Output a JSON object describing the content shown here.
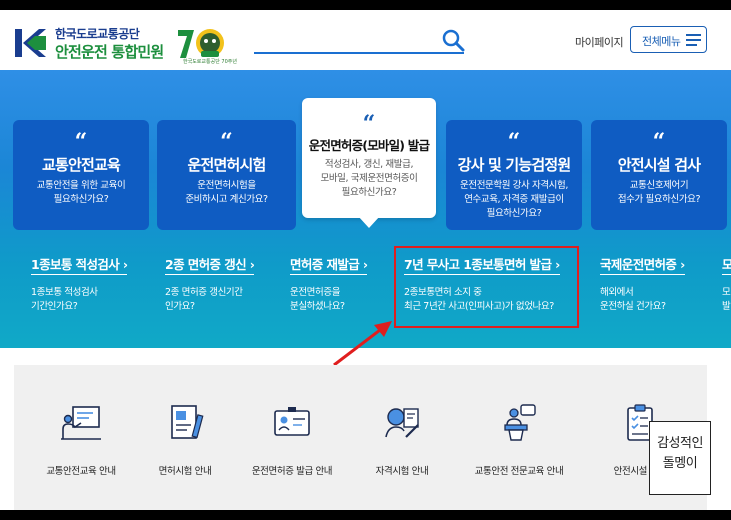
{
  "header": {
    "org_name": "한국도로교통공단",
    "service_name": "안전운전 통합민원",
    "anniversary_number": "70",
    "anniversary_sub": "한국도로교통공단 70주년",
    "search_placeholder": "",
    "mypage_label": "마이페이지",
    "menu_label": "전체메뉴"
  },
  "cards": [
    {
      "title": "교통안전교육",
      "desc": [
        "교통안전을 위한 교육이",
        "필요하신가요?"
      ]
    },
    {
      "title": "운전면허시험",
      "desc": [
        "운전면허시험을",
        "준비하시고 계신가요?"
      ]
    },
    {
      "title": "운전면허증(모바일) 발급",
      "desc": [
        "적성검사, 갱신, 재발급,",
        "모바일, 국제운전면허증이",
        "필요하신가요?"
      ]
    },
    {
      "title": "강사 및 기능검정원",
      "desc": [
        "운전전문학원 강사 자격시험,",
        "연수교육, 자격증 재발급이",
        "필요하신가요?"
      ]
    },
    {
      "title": "안전시설 검사",
      "desc": [
        "교통신호제어기",
        "접수가 필요하신가요?"
      ]
    }
  ],
  "quick_links": [
    {
      "title": "1종보통 적성검사",
      "desc": [
        "1종보통 적성검사",
        "기간인가요?"
      ]
    },
    {
      "title": "2종 면허증 갱신",
      "desc": [
        "2종 면허증 갱신기간",
        "인가요?"
      ]
    },
    {
      "title": "면허증 재발급",
      "desc": [
        "운전면허증을",
        "분실하셨나요?"
      ]
    },
    {
      "title": "7년 무사고 1종보통면허 발급",
      "desc": [
        "2종보통면허 소지 중",
        "최근 7년간 사고(인피사고)가 없었나요?"
      ]
    },
    {
      "title": "국제운전면허증",
      "desc": [
        "해외에서",
        "운전하실 건가요?"
      ]
    },
    {
      "title": "모",
      "desc": [
        "모",
        "발"
      ]
    }
  ],
  "services": [
    {
      "label": "교통안전교육 안내",
      "icon": "teacher-board-icon"
    },
    {
      "label": "면허시험 안내",
      "icon": "license-doc-icon"
    },
    {
      "label": "운전면허증 발급 안내",
      "icon": "id-card-icon"
    },
    {
      "label": "자격시험 안내",
      "icon": "qualification-pen-icon"
    },
    {
      "label": "교통안전 전문교육 안내",
      "icon": "lecture-podium-icon"
    },
    {
      "label": "안전시설 검사",
      "icon": "checklist-icon"
    }
  ],
  "badge": {
    "line1": "감성적인",
    "line2": "돌멩이"
  },
  "colors": {
    "brand_blue": "#1a5fb4",
    "brand_green": "#1d8f3e",
    "card_blue": "#0f5cc2",
    "highlight_red": "#e01e1e"
  }
}
